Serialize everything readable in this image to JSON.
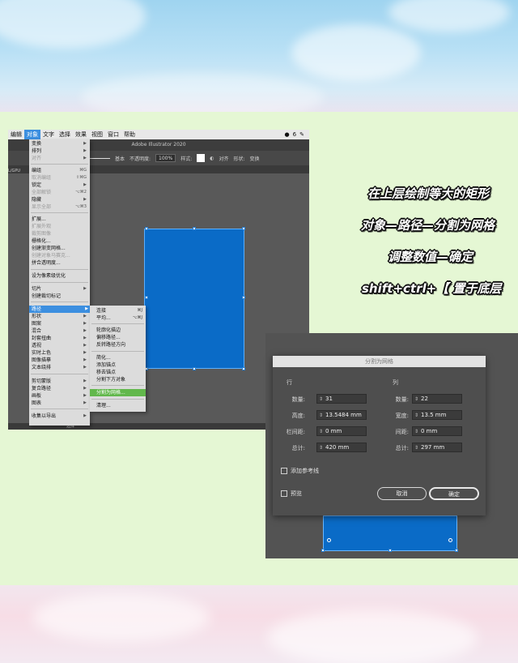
{
  "illustrator": {
    "window_title": "Adobe Illustrator 2020",
    "menubar": [
      "编辑",
      "对象",
      "文字",
      "选择",
      "效果",
      "视图",
      "窗口",
      "帮助"
    ],
    "active_menu": "对象",
    "menubar_right": [
      "6"
    ],
    "controlbar": {
      "stroke_label": "基本",
      "opacity_label": "不透明度:",
      "opacity_value": "100%",
      "style_label": "样式:",
      "align_label": "对齐",
      "shape_label": "形状:",
      "transform_label": "变换"
    },
    "left_tab_label": "L/GPU",
    "object_menu": [
      {
        "label": "变换",
        "shortcut": "▶",
        "disabled": false
      },
      {
        "label": "排列",
        "shortcut": "▶",
        "disabled": false
      },
      {
        "label": "对齐",
        "shortcut": "▶",
        "disabled": true
      },
      {
        "label": "编组",
        "shortcut": "⌘G",
        "disabled": false
      },
      {
        "label": "取消编组",
        "shortcut": "⇧⌘G",
        "disabled": true
      },
      {
        "label": "锁定",
        "shortcut": "▶",
        "disabled": false
      },
      {
        "label": "全部解锁",
        "shortcut": "⌥⌘2",
        "disabled": true
      },
      {
        "label": "隐藏",
        "shortcut": "▶",
        "disabled": false
      },
      {
        "label": "显示全部",
        "shortcut": "⌥⌘3",
        "disabled": true
      },
      {
        "label": "扩展...",
        "shortcut": "",
        "disabled": false
      },
      {
        "label": "扩展外观",
        "shortcut": "",
        "disabled": true
      },
      {
        "label": "裁剪图像",
        "shortcut": "",
        "disabled": true
      },
      {
        "label": "栅格化...",
        "shortcut": "",
        "disabled": false
      },
      {
        "label": "创建渐变网格...",
        "shortcut": "",
        "disabled": false
      },
      {
        "label": "创建对象马赛克...",
        "shortcut": "",
        "disabled": true
      },
      {
        "label": "拼合透明度...",
        "shortcut": "",
        "disabled": false
      },
      {
        "label": "设为像素级优化",
        "shortcut": "",
        "disabled": false
      },
      {
        "label": "切片",
        "shortcut": "▶",
        "disabled": false
      },
      {
        "label": "创建裁切标记",
        "shortcut": "",
        "disabled": false
      },
      {
        "label": "路径",
        "shortcut": "▶",
        "disabled": false,
        "highlighted": true
      },
      {
        "label": "形状",
        "shortcut": "▶",
        "disabled": false
      },
      {
        "label": "图案",
        "shortcut": "▶",
        "disabled": false
      },
      {
        "label": "混合",
        "shortcut": "▶",
        "disabled": false
      },
      {
        "label": "封套扭曲",
        "shortcut": "▶",
        "disabled": false
      },
      {
        "label": "透视",
        "shortcut": "▶",
        "disabled": false
      },
      {
        "label": "实时上色",
        "shortcut": "▶",
        "disabled": false
      },
      {
        "label": "图像描摹",
        "shortcut": "▶",
        "disabled": false
      },
      {
        "label": "文本绕排",
        "shortcut": "▶",
        "disabled": false
      },
      {
        "label": "剪切蒙版",
        "shortcut": "▶",
        "disabled": false
      },
      {
        "label": "复合路径",
        "shortcut": "▶",
        "disabled": false
      },
      {
        "label": "画板",
        "shortcut": "▶",
        "disabled": false
      },
      {
        "label": "图表",
        "shortcut": "▶",
        "disabled": false
      },
      {
        "label": "收集以导出",
        "shortcut": "▶",
        "disabled": false
      }
    ],
    "path_submenu": [
      {
        "label": "连接",
        "shortcut": "⌘J"
      },
      {
        "label": "平均...",
        "shortcut": "⌥⌘J"
      },
      {
        "label": "轮廓化描边",
        "shortcut": ""
      },
      {
        "label": "偏移路径...",
        "shortcut": ""
      },
      {
        "label": "反转路径方向",
        "shortcut": ""
      },
      {
        "label": "简化...",
        "shortcut": ""
      },
      {
        "label": "添加锚点",
        "shortcut": ""
      },
      {
        "label": "移去锚点",
        "shortcut": ""
      },
      {
        "label": "分割下方对象",
        "shortcut": ""
      },
      {
        "label": "分割为网格...",
        "shortcut": "",
        "highlighted": true
      },
      {
        "label": "清理...",
        "shortcut": ""
      }
    ],
    "statusbar_label": "选择"
  },
  "instructions": [
    "在上层绘制等大的矩形",
    "对象—路径—分割为网格",
    "调整数值—确定",
    "shift+ctrl+【  置于底层"
  ],
  "dialog": {
    "title": "分割为网格",
    "rows_header": "行",
    "cols_header": "列",
    "rows": {
      "count_label": "数量:",
      "count": "31",
      "height_label": "高度:",
      "height": "13.5484 mm",
      "gutter_label": "栏间距:",
      "gutter": "0 mm",
      "total_label": "总计:",
      "total": "420 mm"
    },
    "cols": {
      "count_label": "数量:",
      "count": "22",
      "width_label": "宽度:",
      "width": "13.5 mm",
      "gutter_label": "间距:",
      "gutter": "0 mm",
      "total_label": "总计:",
      "total": "297 mm"
    },
    "add_guides_label": "添加参考线",
    "preview_label": "预览",
    "cancel_label": "取消",
    "ok_label": "确定"
  },
  "colors": {
    "artboard_blue": "#0a6bc7",
    "menu_highlight": "#3c8fe0",
    "submenu_highlight": "#62b84c"
  }
}
